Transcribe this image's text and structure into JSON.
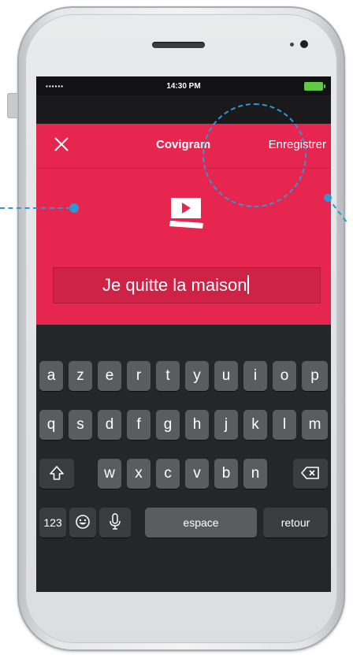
{
  "status_bar": {
    "signal": "▪▪▪▪▪▪",
    "time": "14:30 PM"
  },
  "navbar": {
    "close_icon": "close-icon",
    "title": "Covigram",
    "save_label": "Enregistrer"
  },
  "logo_icon": "video-play-icon",
  "input": {
    "value": "Je quitte la maison"
  },
  "keyboard": {
    "row1": [
      "a",
      "z",
      "e",
      "r",
      "t",
      "y",
      "u",
      "i",
      "o",
      "p"
    ],
    "row2": [
      "q",
      "s",
      "d",
      "f",
      "g",
      "h",
      "j",
      "k",
      "l",
      "m"
    ],
    "row3": [
      "w",
      "x",
      "c",
      "v",
      "b",
      "n"
    ],
    "shift_icon": "shift-icon",
    "backspace_icon": "backspace-icon",
    "numbers_label": "123",
    "emoji_icon": "emoji-icon",
    "mic_icon": "microphone-icon",
    "space_label": "espace",
    "return_label": "retour"
  },
  "colors": {
    "accent": "#e6264f",
    "callout": "#2f97d4",
    "keyboard_bg": "#252628"
  }
}
